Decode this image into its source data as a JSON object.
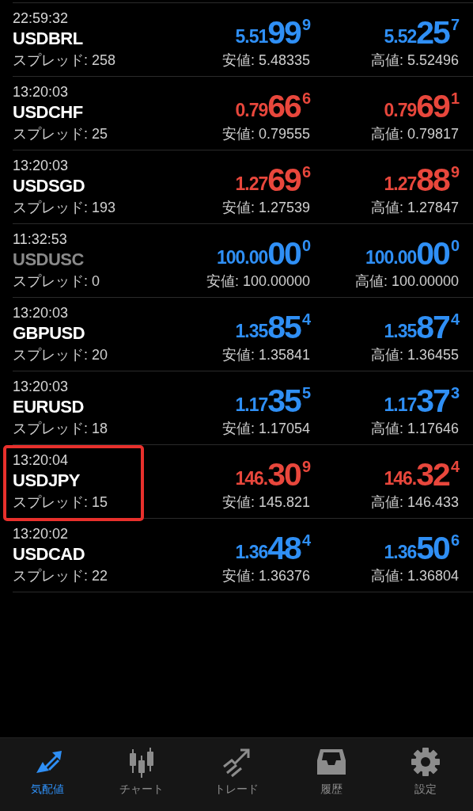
{
  "quotes": [
    {
      "time": "22:59:32",
      "symbol": "USDBRL",
      "disabled": false,
      "highlighted": false,
      "color": "#2f8ff5",
      "spread": "スプレッド: 258",
      "bid": {
        "prefix": "5.51",
        "big": "99",
        "sup": "9"
      },
      "ask": {
        "prefix": "5.52",
        "big": "25",
        "sup": "7"
      },
      "low": "安値: 5.48335",
      "high": "高値: 5.52496"
    },
    {
      "time": "13:20:03",
      "symbol": "USDCHF",
      "disabled": false,
      "highlighted": false,
      "color": "#e8473c",
      "spread": "スプレッド: 25",
      "bid": {
        "prefix": "0.79",
        "big": "66",
        "sup": "6"
      },
      "ask": {
        "prefix": "0.79",
        "big": "69",
        "sup": "1"
      },
      "low": "安値: 0.79555",
      "high": "高値: 0.79817"
    },
    {
      "time": "13:20:03",
      "symbol": "USDSGD",
      "disabled": false,
      "highlighted": false,
      "color": "#e8473c",
      "spread": "スプレッド: 193",
      "bid": {
        "prefix": "1.27",
        "big": "69",
        "sup": "6"
      },
      "ask": {
        "prefix": "1.27",
        "big": "88",
        "sup": "9"
      },
      "low": "安値: 1.27539",
      "high": "高値: 1.27847"
    },
    {
      "time": "11:32:53",
      "symbol": "USDUSC",
      "disabled": true,
      "highlighted": false,
      "color": "#2f8ff5",
      "spread": "スプレッド: 0",
      "bid": {
        "prefix": "100.00",
        "big": "00",
        "sup": "0"
      },
      "ask": {
        "prefix": "100.00",
        "big": "00",
        "sup": "0"
      },
      "low": "安値: 100.00000",
      "high": "高値: 100.00000"
    },
    {
      "time": "13:20:03",
      "symbol": "GBPUSD",
      "disabled": false,
      "highlighted": false,
      "color": "#2f8ff5",
      "spread": "スプレッド: 20",
      "bid": {
        "prefix": "1.35",
        "big": "85",
        "sup": "4"
      },
      "ask": {
        "prefix": "1.35",
        "big": "87",
        "sup": "4"
      },
      "low": "安値: 1.35841",
      "high": "高値: 1.36455"
    },
    {
      "time": "13:20:03",
      "symbol": "EURUSD",
      "disabled": false,
      "highlighted": false,
      "color": "#2f8ff5",
      "spread": "スプレッド: 18",
      "bid": {
        "prefix": "1.17",
        "big": "35",
        "sup": "5"
      },
      "ask": {
        "prefix": "1.17",
        "big": "37",
        "sup": "3"
      },
      "low": "安値: 1.17054",
      "high": "高値: 1.17646"
    },
    {
      "time": "13:20:04",
      "symbol": "USDJPY",
      "disabled": false,
      "highlighted": true,
      "color": "#e8473c",
      "spread": "スプレッド: 15",
      "bid": {
        "prefix": "146.",
        "big": "30",
        "sup": "9"
      },
      "ask": {
        "prefix": "146.",
        "big": "32",
        "sup": "4"
      },
      "low": "安値: 145.821",
      "high": "高値: 146.433"
    },
    {
      "time": "13:20:02",
      "symbol": "USDCAD",
      "disabled": false,
      "highlighted": false,
      "color": "#2f8ff5",
      "spread": "スプレッド: 22",
      "bid": {
        "prefix": "1.36",
        "big": "48",
        "sup": "4"
      },
      "ask": {
        "prefix": "1.36",
        "big": "50",
        "sup": "6"
      },
      "low": "安値: 1.36376",
      "high": "高値: 1.36804"
    }
  ],
  "tab_bar": [
    {
      "kind": "quotes",
      "label": "気配値",
      "selected": true
    },
    {
      "kind": "chart",
      "label": "チャート",
      "selected": false
    },
    {
      "kind": "trade",
      "label": "トレード",
      "selected": false
    },
    {
      "kind": "history",
      "label": "履歴",
      "selected": false
    },
    {
      "kind": "settings",
      "label": "設定",
      "selected": false
    }
  ]
}
